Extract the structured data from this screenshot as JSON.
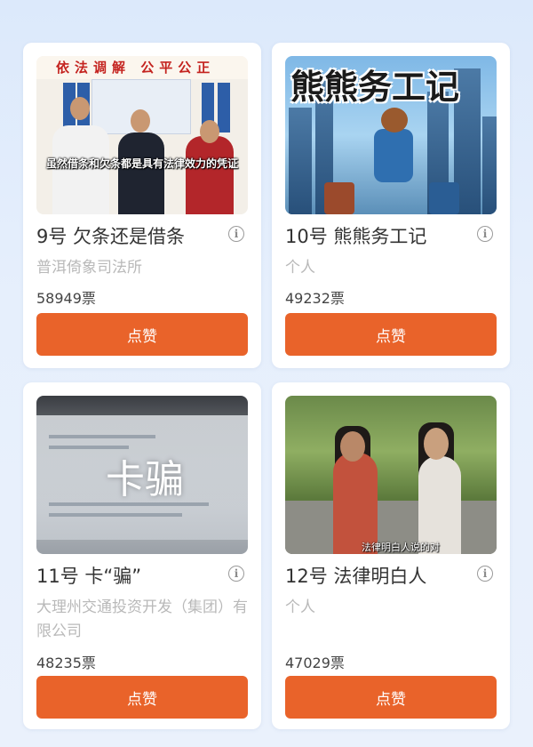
{
  "entries": [
    {
      "title": "9号 欠条还是借条",
      "org": "普洱倚象司法所",
      "votes": "58949票",
      "button": "点赞",
      "thumb": {
        "banner": "依法调解 公平公正",
        "subtitle": "虽然借条和欠条都是具有法律效力的凭证"
      }
    },
    {
      "title": "10号 熊熊务工记",
      "org": "个人",
      "votes": "49232票",
      "button": "点赞",
      "thumb": {
        "overlay_title": "熊熊务工记"
      }
    },
    {
      "title": "11号 卡“骗”",
      "org": "大理州交通投资开发（集团）有限公司",
      "votes": "48235票",
      "button": "点赞",
      "thumb": {
        "overlay_title": "卡骗"
      }
    },
    {
      "title": "12号 法律明白人",
      "org": "个人",
      "votes": "47029票",
      "button": "点赞",
      "thumb": {
        "subtitle": "法律明白人说的对"
      }
    }
  ],
  "icons": {
    "info": "info-circle-icon"
  },
  "colors": {
    "button": "#e9632a",
    "background": "#e6effc"
  }
}
